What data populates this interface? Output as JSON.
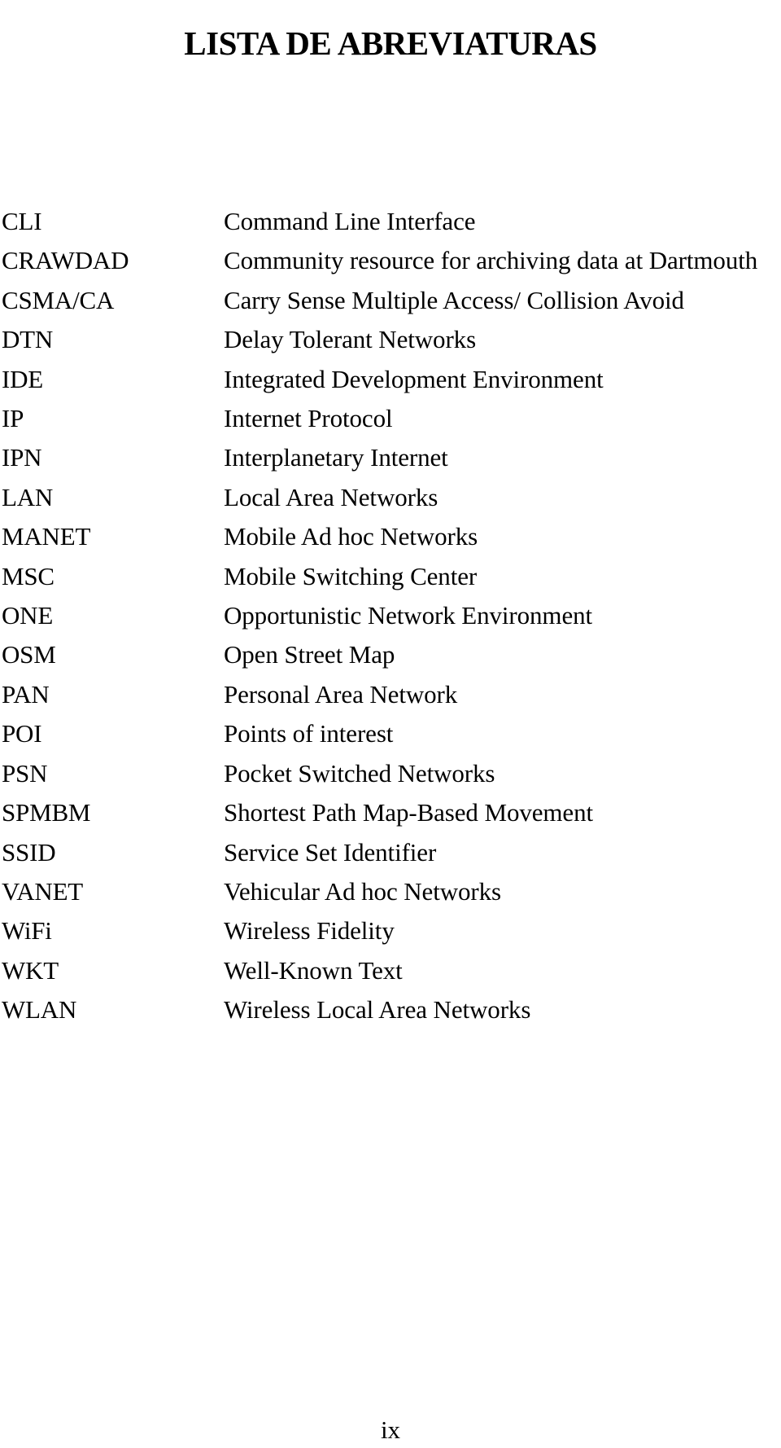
{
  "document": {
    "title": "LISTA DE ABREVIATURAS",
    "page_number": "ix",
    "columns": {
      "abbreviation_header": "",
      "definition_header": ""
    },
    "entries": [
      {
        "abbreviation": "CLI",
        "definition": "Command Line Interface"
      },
      {
        "abbreviation": "CRAWDAD",
        "definition": "Community resource for archiving data at Dartmouth"
      },
      {
        "abbreviation": "CSMA/CA",
        "definition": "Carry Sense Multiple Access/ Collision Avoid"
      },
      {
        "abbreviation": "DTN",
        "definition": "Delay Tolerant Networks"
      },
      {
        "abbreviation": "IDE",
        "definition": "Integrated Development Environment"
      },
      {
        "abbreviation": "IP",
        "definition": "Internet Protocol"
      },
      {
        "abbreviation": "IPN",
        "definition": "Interplanetary Internet"
      },
      {
        "abbreviation": "LAN",
        "definition": "Local Area Networks"
      },
      {
        "abbreviation": "MANET",
        "definition": "Mobile Ad hoc Networks"
      },
      {
        "abbreviation": "MSC",
        "definition": "Mobile Switching Center"
      },
      {
        "abbreviation": "ONE",
        "definition": "Opportunistic Network Environment"
      },
      {
        "abbreviation": "OSM",
        "definition": "Open Street Map"
      },
      {
        "abbreviation": "PAN",
        "definition": "Personal Area Network"
      },
      {
        "abbreviation": "POI",
        "definition": "Points of interest"
      },
      {
        "abbreviation": "PSN",
        "definition": "Pocket Switched Networks"
      },
      {
        "abbreviation": "SPMBM",
        "definition": "Shortest Path Map-Based Movement"
      },
      {
        "abbreviation": "SSID",
        "definition": "Service Set Identifier"
      },
      {
        "abbreviation": "VANET",
        "definition": "Vehicular Ad hoc Networks"
      },
      {
        "abbreviation": "WiFi",
        "definition": "Wireless Fidelity"
      },
      {
        "abbreviation": "WKT",
        "definition": "Well-Known Text"
      },
      {
        "abbreviation": "WLAN",
        "definition": "Wireless Local Area Networks"
      }
    ]
  }
}
